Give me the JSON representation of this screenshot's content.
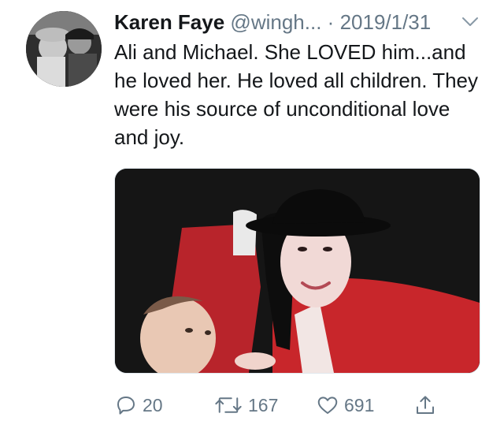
{
  "tweet": {
    "display_name": "Karen Faye",
    "handle": "@wingh...",
    "separator": "·",
    "date": "2019/1/31",
    "text": "Ali and Michael. She LOVED him...and he loved her. He loved all children. They were his source of unconditional love and joy."
  },
  "actions": {
    "reply_count": "20",
    "retweet_count": "167",
    "like_count": "691"
  },
  "icons": {
    "reply": "reply-icon",
    "retweet": "retweet-icon",
    "like": "like-icon",
    "share": "share-icon",
    "menu": "chevron-down-icon"
  },
  "colors": {
    "primary_text": "#14171a",
    "secondary_text": "#657786",
    "photo_jacket": "#c8262b"
  }
}
